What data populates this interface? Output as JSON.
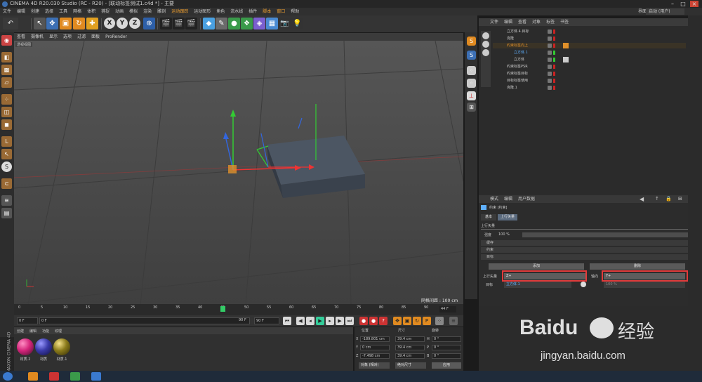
{
  "window": {
    "title": "CINEMA 4D R20.030 Studio (RC - R20) - [联动标签测试1.c4d *] - 主要",
    "layout_label": "界面:",
    "layout_value": "启动 (用户)"
  },
  "menubar": [
    "文件",
    "编辑",
    "创建",
    "选择",
    "工具",
    "网格",
    "体积",
    "捕捉",
    "动画",
    "模拟",
    "渲染",
    "雕刻",
    "运动跟踪",
    "运动图形",
    "角色",
    "流水线",
    "插件",
    "脚本",
    "窗口",
    "帮助"
  ],
  "toolbar": {
    "axis_x": "X",
    "axis_y": "Y",
    "axis_z": "Z"
  },
  "viewport": {
    "menu": [
      "查看",
      "摄像机",
      "显示",
      "选项",
      "过滤",
      "面板",
      "ProRender"
    ],
    "view_label": "透视视图",
    "grid_label": "网格间距 : 100 cm"
  },
  "timeline": {
    "ticks": [
      "0",
      "5",
      "10",
      "15",
      "20",
      "25",
      "30",
      "35",
      "40",
      "45",
      "50",
      "55",
      "60",
      "65",
      "70",
      "75",
      "80",
      "85",
      "90"
    ],
    "current_frame": "44 F",
    "start_field": "0 F",
    "start_field2": "0 F",
    "end_field": "90 F",
    "end_field2": "90 F"
  },
  "material_manager": {
    "menu": [
      "创建",
      "编辑",
      "功能",
      "纹理"
    ],
    "materials": [
      {
        "label": "材质.2",
        "color": "#d4247a"
      },
      {
        "label": "材质",
        "color": "#3a3aa8"
      },
      {
        "label": "材质.1",
        "color": "#8a7a1a"
      }
    ]
  },
  "coords": {
    "headers": [
      "位置",
      "尺寸",
      "旋转"
    ],
    "rows": [
      {
        "axis": "X",
        "pos": "-189.801 cm",
        "size": "39.4 cm",
        "rot_axis": "H",
        "rot": "0 °"
      },
      {
        "axis": "Y",
        "pos": "0 cm",
        "size": "39.4 cm",
        "rot_axis": "P",
        "rot": "0 °"
      },
      {
        "axis": "Z",
        "pos": "-7.498 cm",
        "size": "39.4 cm",
        "rot_axis": "B",
        "rot": "0 °"
      }
    ],
    "mode1": "对象 (相对)",
    "mode2": "绝对尺寸",
    "apply": "应用"
  },
  "object_manager": {
    "menu": [
      "文件",
      "编辑",
      "查看",
      "对象",
      "标签",
      "书签"
    ],
    "objects": [
      {
        "name": "立方体.4.目标",
        "color": "#d0d0d0"
      },
      {
        "name": "克隆",
        "color": "#d0d0d0"
      },
      {
        "name": "约束标签向上",
        "color": "#e0902a"
      },
      {
        "name": "立方体.1",
        "color": "#5fb0ff"
      },
      {
        "name": "立方体",
        "color": "#d0d0d0"
      },
      {
        "name": "约束标签PSR",
        "color": "#d0d0d0"
      },
      {
        "name": "约束标签目标",
        "color": "#d0d0d0"
      },
      {
        "name": "目标标签使用",
        "color": "#d0d0d0"
      },
      {
        "name": "克隆.1",
        "color": "#d0d0d0"
      }
    ]
  },
  "attributes": {
    "menu": [
      "模式",
      "编辑",
      "用户数据"
    ],
    "object_label": "约束 [约束]",
    "tab_basic": "基本",
    "tab_up": "上行矢量",
    "section_up": "上行矢量",
    "strength_label": "强度",
    "strength_value": "100 %",
    "sec_cache": "缓存",
    "sec_constraint": "约束",
    "sec_target": "目标",
    "add_button": "添加",
    "delete_button": "删除",
    "up_vector_label": "上行矢量",
    "up_vector_value": "Z+",
    "axis_label": "轴向",
    "axis_value": "Y+",
    "target_label": "目标",
    "target_value": "立方体.1",
    "weight_value": "100 %"
  },
  "watermark": {
    "brand": "Baidu",
    "cn": "经验",
    "url": "jingyan.baidu.com"
  },
  "left_brand": "MAXON CINEMA 4D"
}
